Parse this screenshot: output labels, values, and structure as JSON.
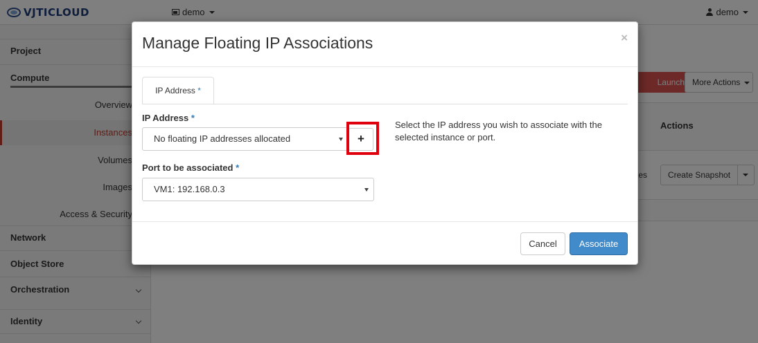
{
  "brand": {
    "logo_text": "VJTICLOUD"
  },
  "topbar": {
    "project_label": "demo",
    "user_label": "demo"
  },
  "sidebar": {
    "project": "Project",
    "compute": "Compute",
    "items": [
      "Overview",
      "Instances",
      "Volumes",
      "Images",
      "Access & Security"
    ],
    "active_item": "Instances",
    "network": "Network",
    "object_store": "Object Store",
    "orchestration": "Orchestration",
    "identity": "Identity"
  },
  "main": {
    "launch_button": "Launch Instances",
    "more_actions": "More Actions",
    "actions_header": "Actions",
    "row_partial": "tes",
    "create_snapshot": "Create Snapshot"
  },
  "modal": {
    "title": "Manage Floating IP Associations",
    "close_symbol": "×",
    "tab_label": "IP Address",
    "required_marker": "*",
    "ip_label": "IP Address",
    "ip_value": "No floating IP addresses allocated",
    "add_symbol": "+",
    "port_label": "Port to be associated",
    "port_value": "VM1: 192.168.0.3",
    "help_text": "Select the IP address you wish to associate with the selected instance or port.",
    "cancel": "Cancel",
    "associate": "Associate"
  },
  "colors": {
    "danger": "#d9534f",
    "primary": "#428bca",
    "highlight_box": "#e0000d",
    "active_accent": "#c0392b"
  }
}
